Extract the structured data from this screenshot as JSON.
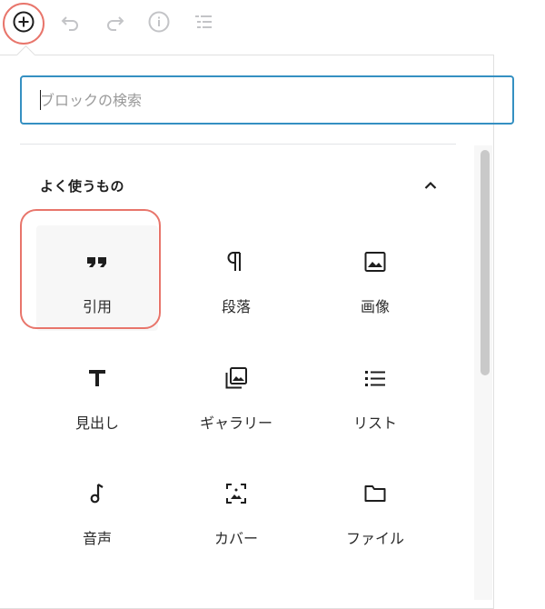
{
  "toolbar": {
    "buttons": [
      {
        "name": "add-block",
        "icon": "plus-circle-icon"
      },
      {
        "name": "undo",
        "icon": "undo-icon"
      },
      {
        "name": "redo",
        "icon": "redo-icon"
      },
      {
        "name": "info",
        "icon": "info-icon"
      },
      {
        "name": "outline",
        "icon": "list-outline-icon"
      }
    ]
  },
  "inserter": {
    "search": {
      "placeholder": "ブロックの検索",
      "value": ""
    },
    "section": {
      "title": "よく使うもの",
      "expanded": true
    },
    "blocks": [
      {
        "label": "引用",
        "icon": "quote-icon",
        "selected": true
      },
      {
        "label": "段落",
        "icon": "paragraph-icon"
      },
      {
        "label": "画像",
        "icon": "image-icon"
      },
      {
        "label": "見出し",
        "icon": "heading-icon"
      },
      {
        "label": "ギャラリー",
        "icon": "gallery-icon"
      },
      {
        "label": "リスト",
        "icon": "list-icon"
      },
      {
        "label": "音声",
        "icon": "audio-icon"
      },
      {
        "label": "カバー",
        "icon": "cover-icon"
      },
      {
        "label": "ファイル",
        "icon": "file-icon"
      }
    ]
  },
  "colors": {
    "accent": "#3590c2",
    "highlight": "#e8756b",
    "icon": "#1e1e1e",
    "disabled_icon": "#c3c4c7"
  }
}
